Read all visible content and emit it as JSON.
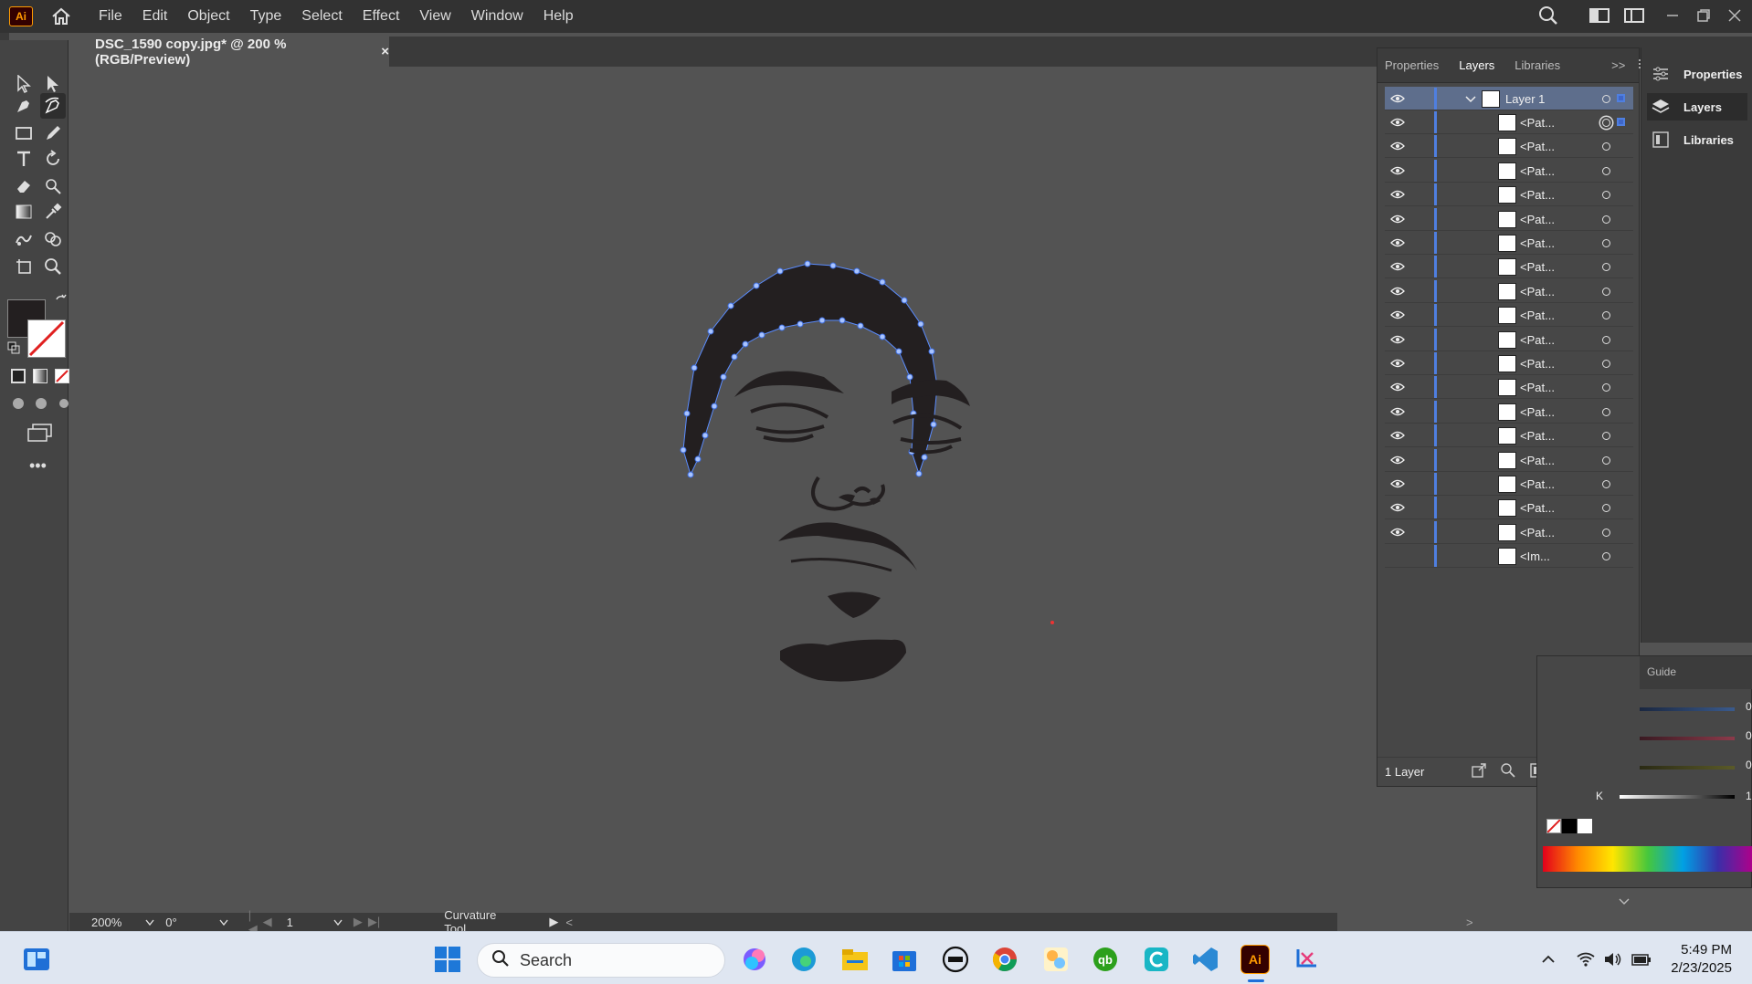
{
  "app": {
    "logo_text": "Ai",
    "menu": [
      "File",
      "Edit",
      "Object",
      "Type",
      "Select",
      "Effect",
      "View",
      "Window",
      "Help"
    ]
  },
  "document": {
    "tab_title": "DSC_1590 copy.jpg* @ 200 % (RGB/Preview)",
    "close_glyph": "×"
  },
  "layers_panel": {
    "tabs": [
      "Properties",
      "Layers",
      "Libraries"
    ],
    "active_tab": "Layers",
    "overflow_glyph": ">>",
    "layer_name": "Layer 1",
    "items": [
      "<Pat...",
      "<Pat...",
      "<Pat...",
      "<Pat...",
      "<Pat...",
      "<Pat...",
      "<Pat...",
      "<Pat...",
      "<Pat...",
      "<Pat...",
      "<Pat...",
      "<Pat...",
      "<Pat...",
      "<Pat...",
      "<Pat...",
      "<Pat...",
      "<Pat...",
      "<Pat...",
      "<Im..."
    ],
    "footer_count": "1 Layer"
  },
  "dock": {
    "items": [
      "Properties",
      "Layers",
      "Libraries"
    ],
    "active": "Layers"
  },
  "color_panel": {
    "guide_label": "Guide",
    "k_label": "K",
    "values": [
      "0",
      "0",
      "0",
      "1"
    ]
  },
  "status": {
    "zoom": "200%",
    "rotation": "0°",
    "artboard": "1",
    "tool_name": "Curvature Tool"
  },
  "taskbar": {
    "search_placeholder": "Search",
    "time": "5:49 PM",
    "date": "2/23/2025"
  },
  "colors": {
    "accent": "#4f7fe0",
    "fill_swatch": "#231f20",
    "ai_orange": "#ff9a00"
  }
}
